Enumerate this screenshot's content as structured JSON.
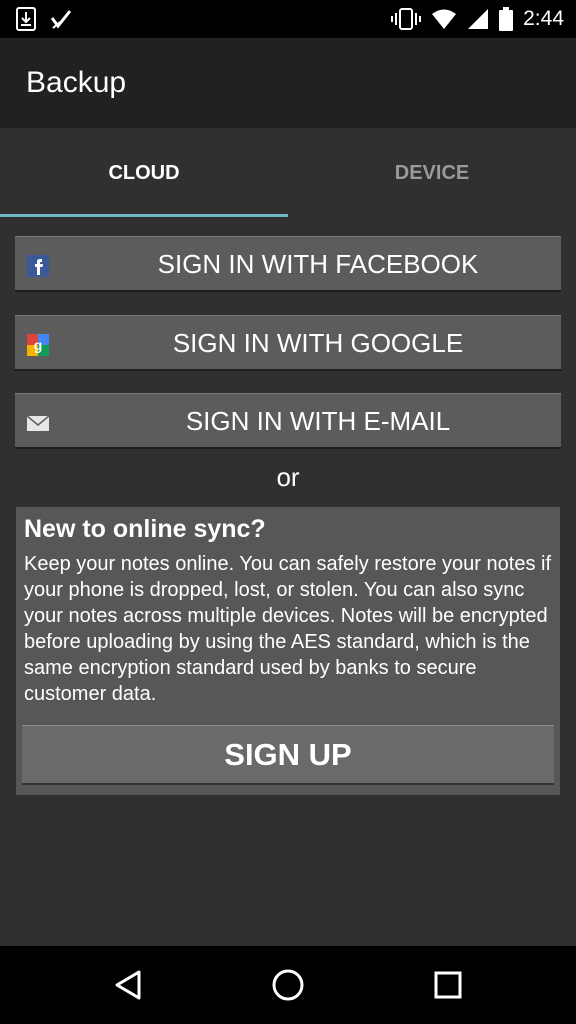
{
  "status_bar": {
    "time": "2:44",
    "left_icons": [
      "download-icon",
      "check-icon"
    ],
    "right_icons": [
      "vibrate-icon",
      "wifi-icon",
      "signal-icon",
      "battery-icon"
    ]
  },
  "app_bar": {
    "title": "Backup"
  },
  "tabs": [
    {
      "label": "CLOUD",
      "selected": true
    },
    {
      "label": "DEVICE",
      "selected": false
    }
  ],
  "sign_in": {
    "facebook_label": "SIGN IN WITH FACEBOOK",
    "google_label": "SIGN IN WITH GOOGLE",
    "email_label": "SIGN IN WITH E-MAIL",
    "or_text": "or"
  },
  "signup_card": {
    "heading": "New to online sync?",
    "body": "Keep your notes online. You can safely restore your notes if your phone is dropped, lost, or stolen. You can also sync your notes across multiple devices. Notes will be encrypted before uploading by using the AES standard, which is the same encryption standard used by banks to secure customer data.",
    "button_label": "SIGN UP"
  },
  "colors": {
    "accent_indicator": "#6fb7c7",
    "button_bg": "#5c5c5c",
    "card_bg": "#575757",
    "app_bar_bg": "#212121"
  }
}
